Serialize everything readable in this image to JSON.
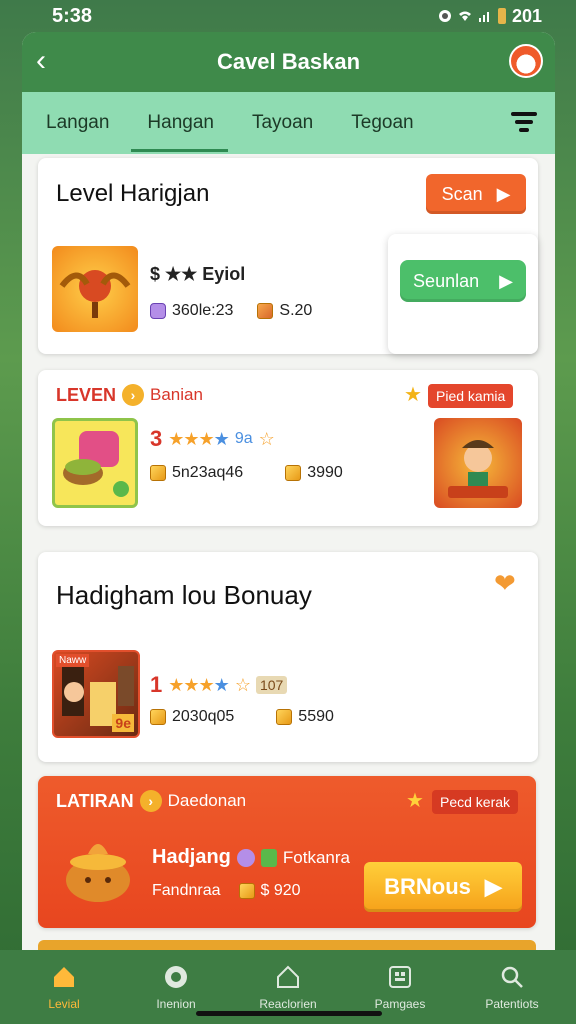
{
  "status_bar": {
    "time": "5:38",
    "battery_text": "201"
  },
  "header": {
    "title": "Cavel Baskan",
    "back_icon": "chevron-left-icon",
    "avatar_icon": "mascot-icon"
  },
  "tabs": [
    {
      "label": "Langan",
      "active": false
    },
    {
      "label": "Hangan",
      "active": true
    },
    {
      "label": "Tayoan",
      "active": false
    },
    {
      "label": "Tegoan",
      "active": false
    }
  ],
  "card1": {
    "title": "Level Harigjan",
    "scan_button": "Scan",
    "rating_text": "$ ★★ Eyiol",
    "stat1": "360le:23",
    "stat2": "S.20",
    "popup_button": "Seunlan"
  },
  "card2": {
    "heading": "LEVEN",
    "subheading": "Banian",
    "tag": "Pied kamia",
    "rating_num": "3",
    "rating_suffix": "9a",
    "stat1": "5n23aq46",
    "stat2": "3990"
  },
  "card3": {
    "title": "Hadigham lou Bonuay",
    "thumb_badge": "Naww",
    "thumb_corner": "9e",
    "rating_num": "1",
    "rating_suffix": "107",
    "stat1": "2030q05",
    "stat2": "5590"
  },
  "card4": {
    "heading": "LATIRAN",
    "subheading": "Daedonan",
    "tag": "Pecd kerak",
    "name": "Hadjang",
    "name_suffix": "Fotkanra",
    "sub": "Fandnraa",
    "price": "$ 920",
    "button": "BRNous"
  },
  "bottom_nav": [
    {
      "label": "Levial",
      "icon": "home-icon",
      "active": true
    },
    {
      "label": "Inenion",
      "icon": "target-icon",
      "active": false
    },
    {
      "label": "Reaclorien",
      "icon": "house-outline-icon",
      "active": false
    },
    {
      "label": "Pamgaes",
      "icon": "grid-icon",
      "active": false
    },
    {
      "label": "Patentiots",
      "icon": "search-icon",
      "active": false
    }
  ],
  "colors": {
    "header": "#3f8a4a",
    "tab_bar": "#8fdcb2",
    "accent_orange": "#f1662c",
    "accent_green": "#4cbf6a",
    "nav_active": "#ffb93a"
  }
}
